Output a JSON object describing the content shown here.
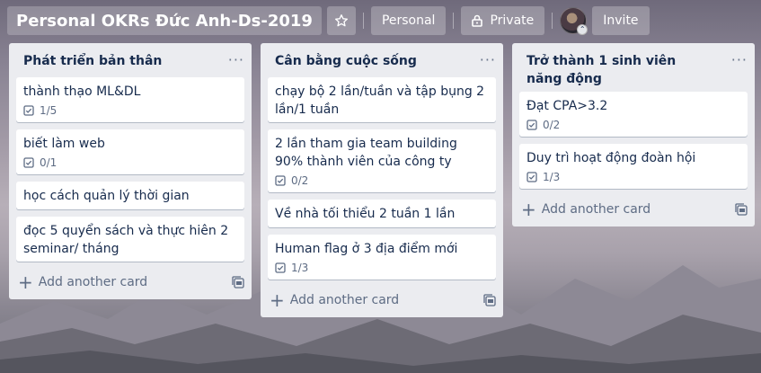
{
  "board": {
    "title": "Personal OKRs Đức Anh-Ds-2019",
    "visibility_team": "Personal",
    "visibility_private": "Private",
    "invite_label": "Invite",
    "star_icon": "star-icon",
    "lock_icon": "lock-icon"
  },
  "lists": [
    {
      "title": "Phát triển bản thân",
      "cards": [
        {
          "title": "thành thạo ML&DL",
          "checklist": "1/5"
        },
        {
          "title": "biết làm web",
          "checklist": "0/1"
        },
        {
          "title": "học cách quản lý thời gian",
          "checklist": null
        },
        {
          "title": "đọc 5 quyển sách và thực hiên 2 seminar/ tháng",
          "checklist": null
        }
      ],
      "add_card": "Add another card"
    },
    {
      "title": "Cân bằng cuộc sống",
      "cards": [
        {
          "title": "chạy bộ 2 lần/tuần và tập bụng 2 lần/1 tuần",
          "checklist": null
        },
        {
          "title": "2 lần tham gia team building 90% thành viên của công ty",
          "checklist": "0/2"
        },
        {
          "title": "Về nhà tối thiểu 2 tuần 1 lần",
          "checklist": null
        },
        {
          "title": "Human flag ở 3 địa điểm mới",
          "checklist": "1/3"
        }
      ],
      "add_card": "Add another card"
    },
    {
      "title": "Trở thành 1 sinh viên năng động",
      "cards": [
        {
          "title": "Đạt CPA>3.2",
          "checklist": "0/2"
        },
        {
          "title": "Duy trì hoạt động đoàn hội",
          "checklist": "1/3"
        }
      ],
      "add_card": "Add another card"
    }
  ],
  "menu_glyph": "···",
  "plus_glyph": "+"
}
